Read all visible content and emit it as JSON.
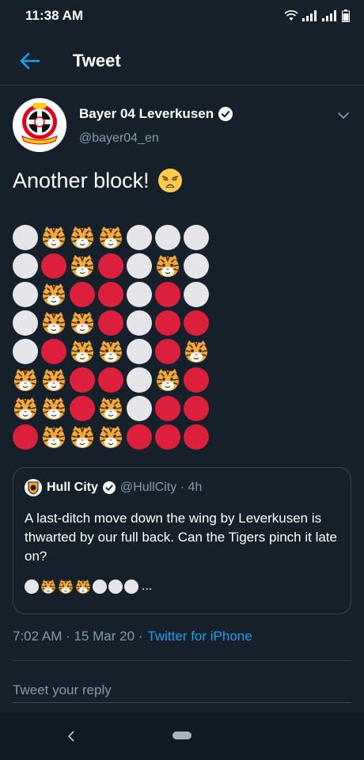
{
  "status_bar": {
    "time": "11:38 AM",
    "battery_level": "37"
  },
  "header": {
    "title": "Tweet"
  },
  "tweet": {
    "author_name": "Bayer 04 Leverkusen",
    "author_handle": "@bayer04_en",
    "text": "Another block!",
    "grid": [
      [
        "W",
        "T",
        "T",
        "T",
        "W",
        "W",
        "W"
      ],
      [
        "W",
        "R",
        "T",
        "R",
        "W",
        "T",
        "W"
      ],
      [
        "W",
        "T",
        "R",
        "R",
        "W",
        "R",
        "W"
      ],
      [
        "W",
        "T",
        "T",
        "R",
        "W",
        "R",
        "R"
      ],
      [
        "W",
        "R",
        "T",
        "T",
        "W",
        "R",
        "T"
      ],
      [
        "T",
        "T",
        "R",
        "R",
        "W",
        "T",
        "R"
      ],
      [
        "T",
        "T",
        "R",
        "T",
        "W",
        "R",
        "R"
      ],
      [
        "R",
        "T",
        "T",
        "T",
        "R",
        "R",
        "R"
      ]
    ],
    "grid_legend": {
      "W": "white circle",
      "R": "red circle",
      "T": "tiger face"
    },
    "timestamp": "7:02 AM · 15 Mar 20 · ",
    "source": "Twitter for iPhone"
  },
  "quote": {
    "author_name": "Hull City",
    "author_handle": "@HullCity · 4h",
    "text": "A last-ditch move down the wing by Leverkusen is thwarted by our full back. Can the Tigers pinch it late on?",
    "emoji_line": [
      "W",
      "T",
      "T",
      "T",
      "W",
      "W",
      "W"
    ],
    "ellipsis": "..."
  },
  "reply": {
    "placeholder": "Tweet your reply"
  },
  "colors": {
    "background": "#15202b",
    "accent": "#1da1f2",
    "secondary_text": "#8899a6",
    "red_circle": "#dc1f3a",
    "white_circle": "#e6e6ea"
  }
}
